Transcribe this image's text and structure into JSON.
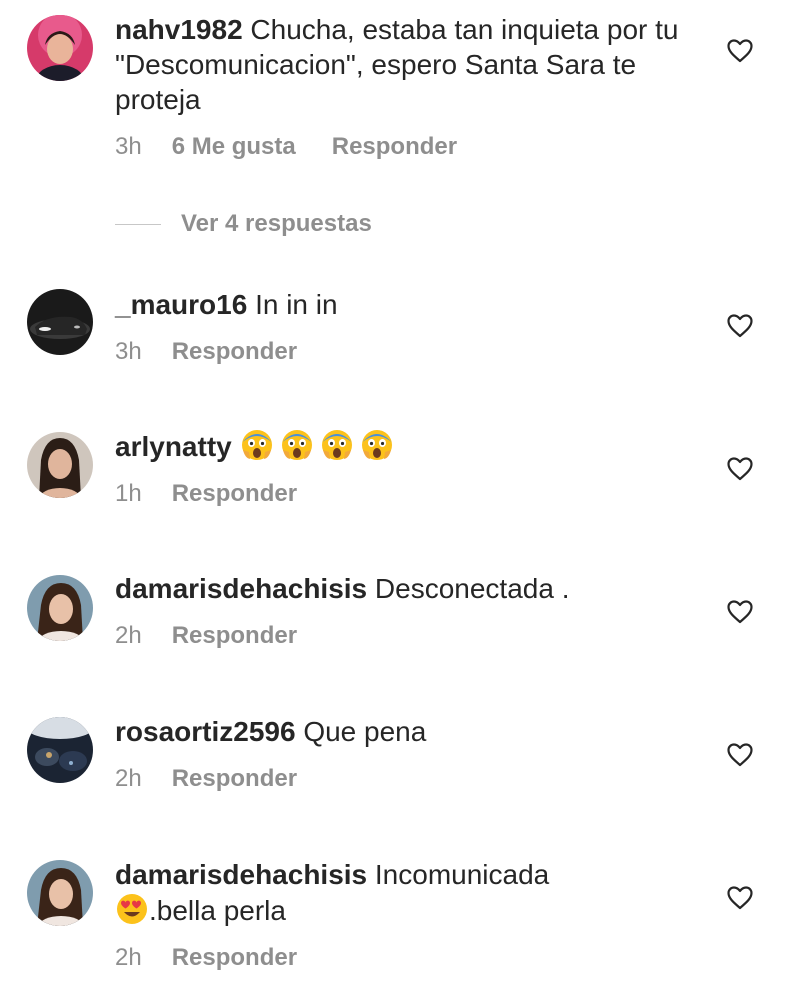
{
  "comments": [
    {
      "username": "nahv1982",
      "text": " Chucha, estaba tan inquieta por tu \"Descomunicacion\", espero Santa Sara te proteja",
      "time": "3h",
      "likes": "6 Me gusta",
      "reply": "Responder"
    },
    {
      "username": "_mauro16",
      "text": " In in in",
      "time": "3h",
      "reply": "Responder"
    },
    {
      "username": "arlynatty",
      "emoji_count": 4,
      "emoji_name": "face-screaming-in-fear",
      "time": "1h",
      "reply": "Responder"
    },
    {
      "username": "damarisdehachisis",
      "text": " Desconectada .",
      "time": "2h",
      "reply": "Responder"
    },
    {
      "username": "rosaortiz2596",
      "text": " Que pena",
      "time": "2h",
      "reply": "Responder"
    },
    {
      "username": "damarisdehachisis",
      "text": " Incomunicada",
      "text_line2": ".bella perla",
      "emoji_name": "smiling-face-with-heart-eyes",
      "time": "2h",
      "reply": "Responder"
    }
  ],
  "view_replies": "Ver 4 respuestas",
  "icons": {
    "like": "heart-outline-icon"
  },
  "colors": {
    "text": "#262626",
    "secondary": "#8e8e8e"
  }
}
